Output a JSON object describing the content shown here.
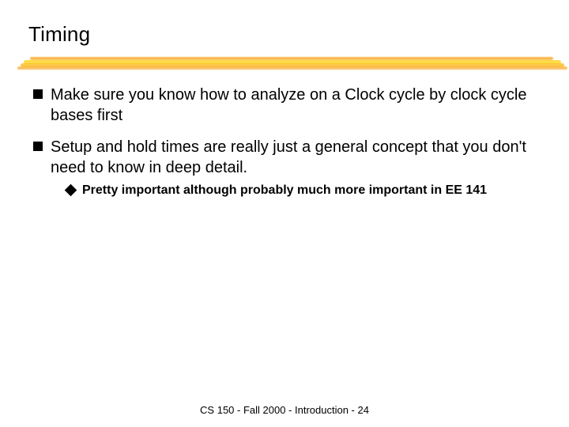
{
  "title": "Timing",
  "bullets": [
    {
      "text": "Make sure you know how to analyze on a Clock cycle by clock cycle bases first",
      "sub": []
    },
    {
      "text": "Setup and hold times are really just a general concept that you don't need to know in deep detail.",
      "sub": [
        "Pretty important although probably much more important in EE 141"
      ]
    }
  ],
  "footer": "CS 150 - Fall 2000 - Introduction - 24"
}
